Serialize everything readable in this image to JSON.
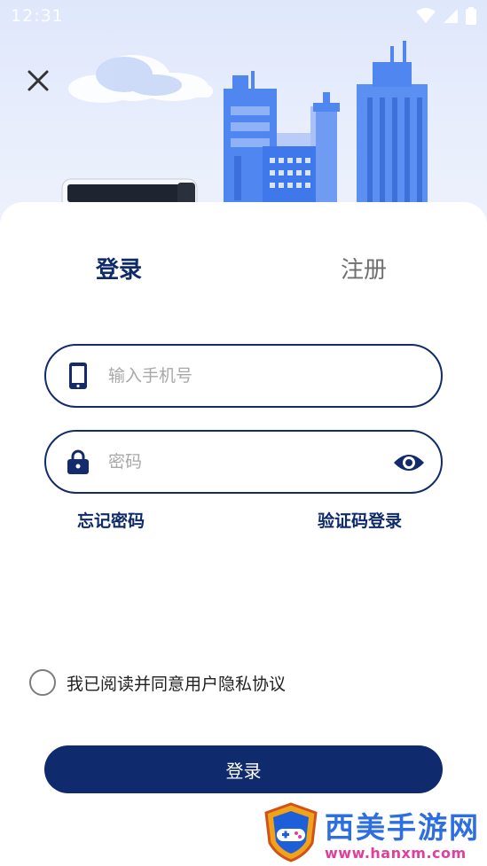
{
  "status_bar": {
    "time": "12:31"
  },
  "tabs": {
    "login": "登录",
    "register": "注册"
  },
  "phone_field": {
    "placeholder": "输入手机号"
  },
  "password_field": {
    "placeholder": "密码"
  },
  "links": {
    "forgot_password": "忘记密码",
    "code_login": "验证码登录"
  },
  "agreement": {
    "text": "我已阅读并同意用户隐私协议",
    "checked": false
  },
  "submit": {
    "label": "登录"
  },
  "watermark": {
    "title": "西美手游网",
    "url": "www.hanxm.com"
  },
  "colors": {
    "primary": "#0f2a6d",
    "tab_inactive": "#6f6f6f",
    "hero_bg": "#e3eafc",
    "building_blue": "#4f86f0"
  },
  "icons": {
    "close": "close-icon",
    "phone": "phone-icon",
    "lock": "lock-icon",
    "eye": "eye-icon",
    "wifi": "wifi-icon",
    "battery": "battery-icon"
  }
}
